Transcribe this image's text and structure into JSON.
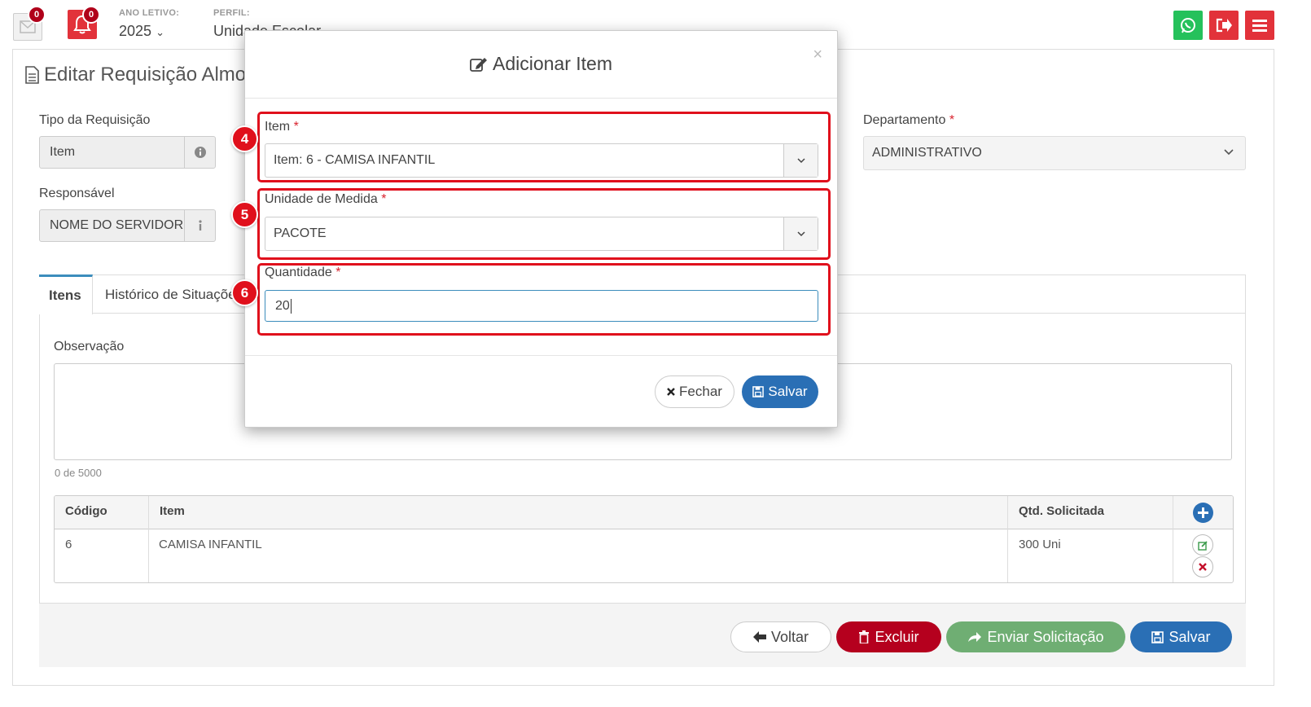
{
  "topbar": {
    "mail_badge": "0",
    "bell_badge": "0",
    "year_label": "ANO LETIVO:",
    "year_value": "2025",
    "profile_label": "PERFIL:",
    "profile_value": "Unidade Escolar"
  },
  "page": {
    "title": "Editar Requisição Almoxarifado"
  },
  "form": {
    "tipo_label": "Tipo da Requisição",
    "tipo_value": "Item",
    "responsavel_label": "Responsável",
    "responsavel_value": "NOME DO SERVIDOR",
    "departamento_label": "Departamento",
    "departamento_value": "ADMINISTRATIVO",
    "required_mark": "*"
  },
  "tabs": [
    {
      "label": "Itens",
      "active": true
    },
    {
      "label": "Histórico de Situações",
      "active": false
    }
  ],
  "observacao": {
    "label": "Observação",
    "counter": "0 de 5000"
  },
  "table": {
    "columns": [
      "Código",
      "Item",
      "Qtd. Solicitada"
    ],
    "rows": [
      {
        "codigo": "6",
        "item": "CAMISA INFANTIL",
        "qtd": "300 Uni"
      }
    ]
  },
  "footer": {
    "voltar": "Voltar",
    "excluir": "Excluir",
    "enviar": "Enviar Solicitação",
    "salvar": "Salvar"
  },
  "modal": {
    "title": "Adicionar Item",
    "close": "×",
    "item_label": "Item",
    "item_value": "Item: 6 - CAMISA INFANTIL",
    "unidade_label": "Unidade de Medida",
    "unidade_value": "PACOTE",
    "quantidade_label": "Quantidade",
    "quantidade_value": "20",
    "fechar": "Fechar",
    "salvar": "Salvar",
    "steps": [
      "4",
      "5",
      "6"
    ]
  },
  "colors": {
    "accent_blue": "#3c8dbc",
    "danger_red": "#b5001e",
    "success_green": "#6fae73",
    "whatsapp_green": "#25c15b",
    "highlight_red": "#e0101c"
  }
}
